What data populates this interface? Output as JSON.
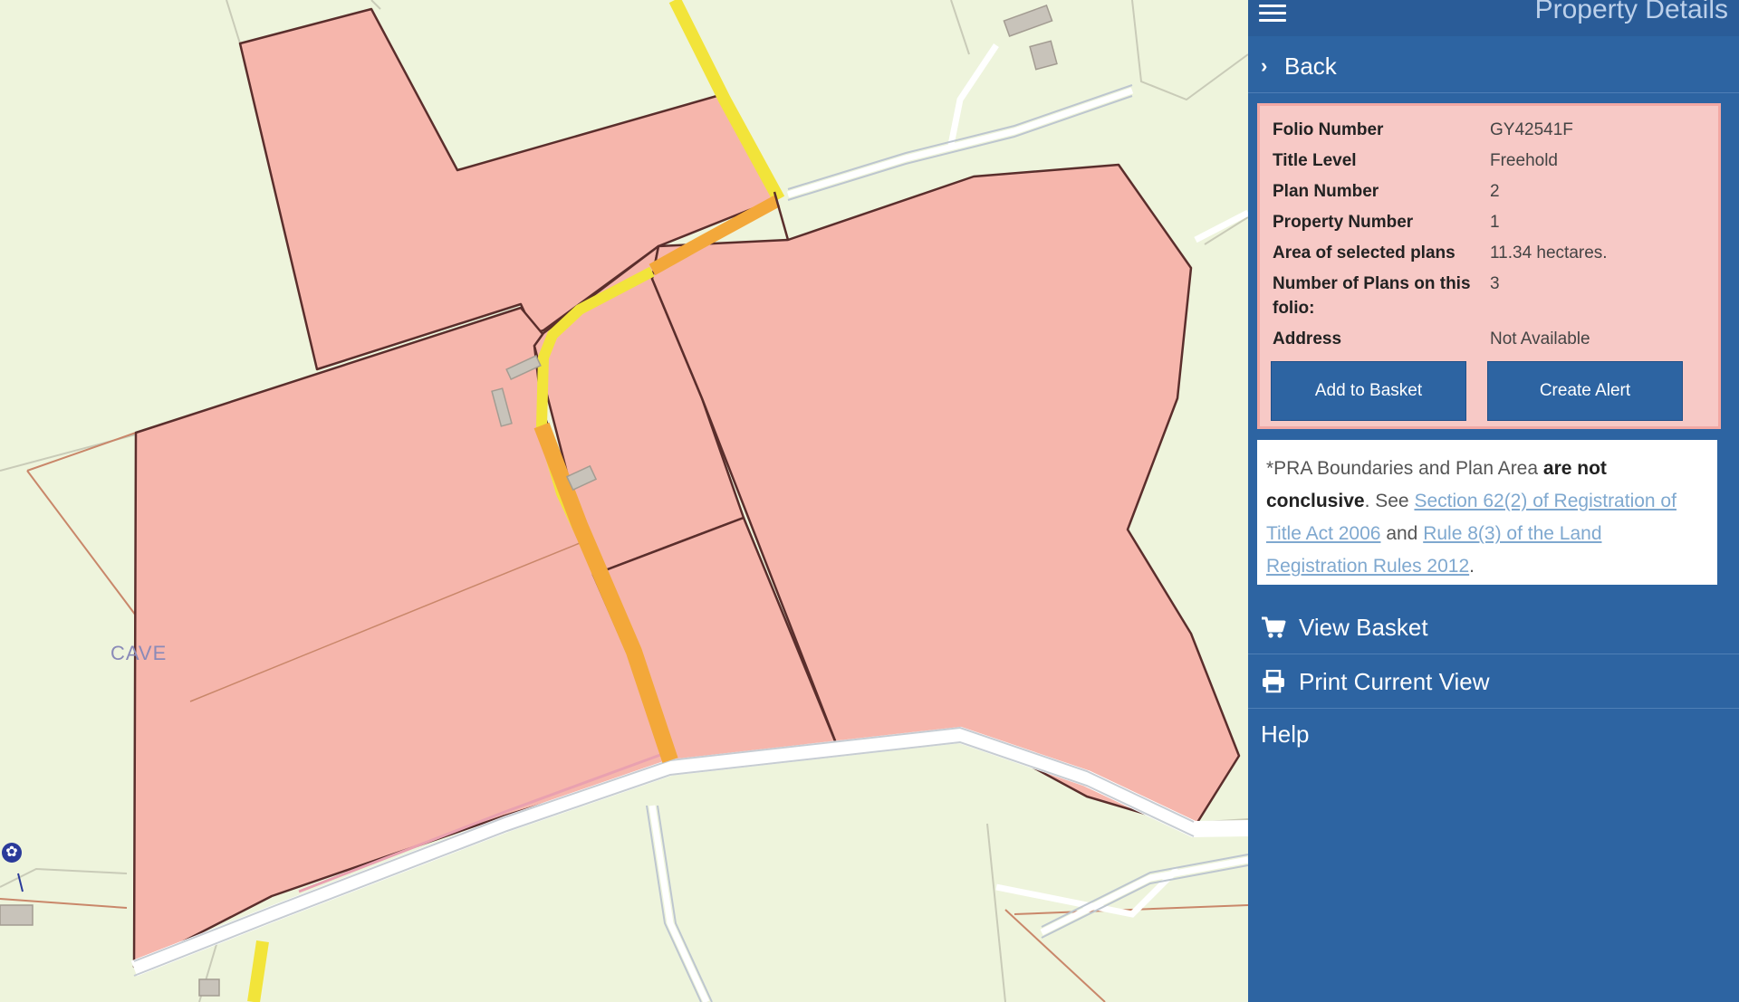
{
  "map": {
    "place_label": "CAVE"
  },
  "panel": {
    "title": "Property Details",
    "back_label": "Back",
    "details": [
      {
        "label": "Folio Number",
        "value": "GY42541F"
      },
      {
        "label": "Title Level",
        "value": "Freehold"
      },
      {
        "label": "Plan Number",
        "value": "2"
      },
      {
        "label": "Property Number",
        "value": "1"
      },
      {
        "label": "Area of selected plans",
        "value": "11.34 hectares."
      },
      {
        "label": "Number of Plans on this folio:",
        "value": "3"
      },
      {
        "label": "Address",
        "value": "Not Available"
      }
    ],
    "add_to_basket": "Add to Basket",
    "create_alert": "Create Alert",
    "notice": {
      "prefix": "*PRA Boundaries and Plan Area",
      "bold": "are not conclusive",
      "see": ". See",
      "link1": "Section 62(2) of Registration of Title Act 2006",
      "and": "and",
      "link2": "Rule 8(3) of the Land Registration Rules 2012",
      "suffix": "."
    },
    "menu": {
      "view_basket": "View Basket",
      "print_view": "Print Current View",
      "help": "Help"
    }
  },
  "colors": {
    "panel_bg": "#2d64a2",
    "parcel_fill": "#f6b6ac",
    "map_bg": "#eef4dc",
    "road_yellow": "#f2e43a",
    "road_orange": "#f3a83a"
  }
}
